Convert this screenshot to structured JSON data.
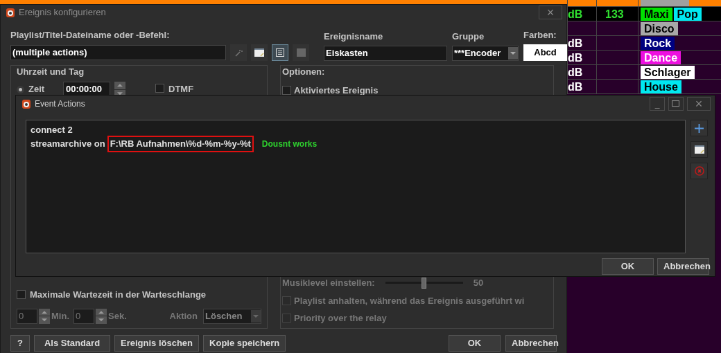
{
  "background_table": {
    "rows": [
      {
        "kind": "next",
        "column_1": "",
        "column_2": "",
        "tags": [
          {
            "color": "#a0a0a0"
          }
        ]
      },
      {
        "kind": "playing",
        "column_1": "dB",
        "column_2": "133",
        "tags": [
          {
            "label": "Maxi",
            "color": "#00e000"
          },
          {
            "label": "Pop",
            "color": "#00e8f0"
          }
        ]
      },
      {
        "kind": "normal",
        "column_1": "",
        "column_2": "",
        "tags": [
          {
            "label": "Disco",
            "color": "#a8a8a8"
          }
        ]
      },
      {
        "kind": "normal",
        "column_1": "dB",
        "column_2": "",
        "tags": [
          {
            "label": "Rock",
            "color": "#000080"
          }
        ]
      },
      {
        "kind": "normal",
        "column_1": "dB",
        "column_2": "",
        "tags": [
          {
            "label": "Dance",
            "color": "#ee10e0"
          }
        ]
      },
      {
        "kind": "normal",
        "column_1": "dB",
        "column_2": "",
        "tags": [
          {
            "label": "Schlager",
            "color": "#ffffff"
          }
        ]
      },
      {
        "kind": "normal",
        "column_1": "dB",
        "column_2": "",
        "tags": [
          {
            "label": "House",
            "color": "#00e8f0"
          }
        ]
      }
    ]
  },
  "main_dialog": {
    "title": "Ereignis konfigurieren",
    "close": "×",
    "playlist_label": "Playlist/Titel-Dateiname oder -Befehl:",
    "playlist_value": "(multiple actions)",
    "tool_buttons": [
      {
        "kind": "wand",
        "selected": false
      },
      {
        "kind": "note",
        "selected": false
      },
      {
        "kind": "list",
        "selected": true
      },
      {
        "kind": "square",
        "selected": false
      }
    ],
    "event_name_label": "Ereignisname",
    "event_name_value": "Eiskasten",
    "group_label": "Gruppe",
    "group_value": "***Encoder",
    "colors_label": "Farben:",
    "colors_sample": "Abcd",
    "time_group": {
      "title": "Uhrzeit und Tag",
      "time_radio": {
        "label": "Zeit",
        "selected": true
      },
      "time_value": "00:00:00",
      "dtmf": {
        "label": "DTMF",
        "checked": false
      },
      "max_wait": {
        "label": "Maximale Wartezeit in der Warteschlange",
        "checked": false
      },
      "minutes": "0",
      "minutes_label": "Min.",
      "seconds": "0",
      "seconds_label": "Sek.",
      "action_label": "Aktion",
      "action_value": "Löschen"
    },
    "options": {
      "title": "Optionen:",
      "top_checkboxes": [
        {
          "label": "Aktiviertes Ereignis",
          "checked": false
        }
      ],
      "music_level": {
        "label": "Musiklevel einstellen:",
        "level": 0.5,
        "reading": "50"
      },
      "bottom_checkboxes": [
        {
          "label": "Playlist anhalten, während das Ereignis ausgeführt wi",
          "checked": false,
          "disabled": true
        },
        {
          "label": "Priority over the relay",
          "checked": false,
          "disabled": true
        }
      ]
    },
    "buttons_left": [
      "?",
      "Als Standard",
      "Ereignis löschen",
      "Kopie speichern"
    ],
    "buttons_right": [
      "OK",
      "Abbrechen"
    ]
  },
  "event_actions": {
    "title": "Event Actions",
    "minimize": "_",
    "close": "×",
    "lines": [
      {
        "text": "connect 2"
      },
      {
        "text": "streamarchive on",
        "highlighted": "F:\\RB Aufnahmen\\%d-%m-%y-%t",
        "note": "Dousnt works"
      }
    ],
    "buttons": [
      "OK",
      "Abbrechen"
    ]
  }
}
